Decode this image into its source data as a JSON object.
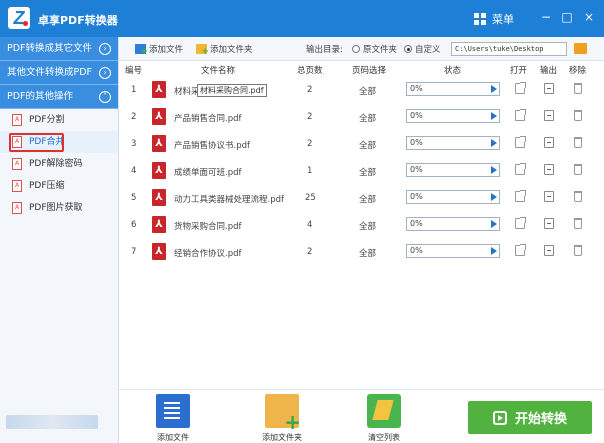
{
  "app": {
    "title": "卓享PDF转换器",
    "menu_label": "菜单"
  },
  "window": {
    "minimize": "−",
    "restore": "□",
    "close": "×"
  },
  "sidebar": {
    "categories": [
      {
        "label": "PDF转换成其它文件",
        "expander": "›"
      },
      {
        "label": "其他文件转换成PDF",
        "expander": "›"
      },
      {
        "label": "PDF的其他操作",
        "expander": "˅"
      }
    ],
    "items": [
      {
        "label": "PDF分割",
        "active": false
      },
      {
        "label": "PDF合并",
        "active": true
      },
      {
        "label": "PDF解除密码",
        "active": false
      },
      {
        "label": "PDF压缩",
        "active": false
      },
      {
        "label": "PDF图片获取",
        "active": false
      }
    ]
  },
  "toolbar": {
    "add_file": "添加文件",
    "add_folder": "添加文件夹",
    "output_dir_label": "输出目录:",
    "original_folder": "原文件夹",
    "custom": "自定义",
    "output_path": "C:\\Users\\tuke\\Desktop"
  },
  "table": {
    "headers": {
      "index": "编号",
      "filename": "文件名称",
      "pages": "总页数",
      "page_select": "页码选择",
      "status": "状态",
      "open": "打开",
      "output": "输出",
      "remove": "移除"
    },
    "rows": [
      {
        "index": "1",
        "name": "材料采购合同.pdf",
        "pages": "2",
        "range": "全部",
        "progress": "0%"
      },
      {
        "index": "2",
        "name": "产品销售合同.pdf",
        "pages": "2",
        "range": "全部",
        "progress": "0%"
      },
      {
        "index": "3",
        "name": "产品销售协议书.pdf",
        "pages": "2",
        "range": "全部",
        "progress": "0%"
      },
      {
        "index": "4",
        "name": "成绩单面可班.pdf",
        "pages": "1",
        "range": "全部",
        "progress": "0%"
      },
      {
        "index": "5",
        "name": "动力工具类器械处理流程.pdf",
        "pages": "25",
        "range": "全部",
        "progress": "0%"
      },
      {
        "index": "6",
        "name": "货物采购合同.pdf",
        "pages": "4",
        "range": "全部",
        "progress": "0%"
      },
      {
        "index": "7",
        "name": "经销合作协议.pdf",
        "pages": "2",
        "range": "全部",
        "progress": "0%"
      }
    ],
    "row1_visible_name": "材料采",
    "tooltip": "材料采购合同.pdf"
  },
  "bottom": {
    "add_file": "添加文件",
    "add_folder": "添加文件夹",
    "clear_list": "清空列表",
    "start": "开始转换"
  },
  "colors": {
    "titlebar": "#1e7fd6",
    "category": "#3a8ee0",
    "start_button": "#52b240",
    "pdf_red": "#c9262c"
  },
  "icons": {
    "toolbar": [
      "add-file-icon",
      "add-folder-icon",
      "browse-folder-icon"
    ],
    "row": [
      "pdf-file-icon",
      "play-icon",
      "open-icon",
      "output-icon",
      "trash-icon"
    ]
  }
}
